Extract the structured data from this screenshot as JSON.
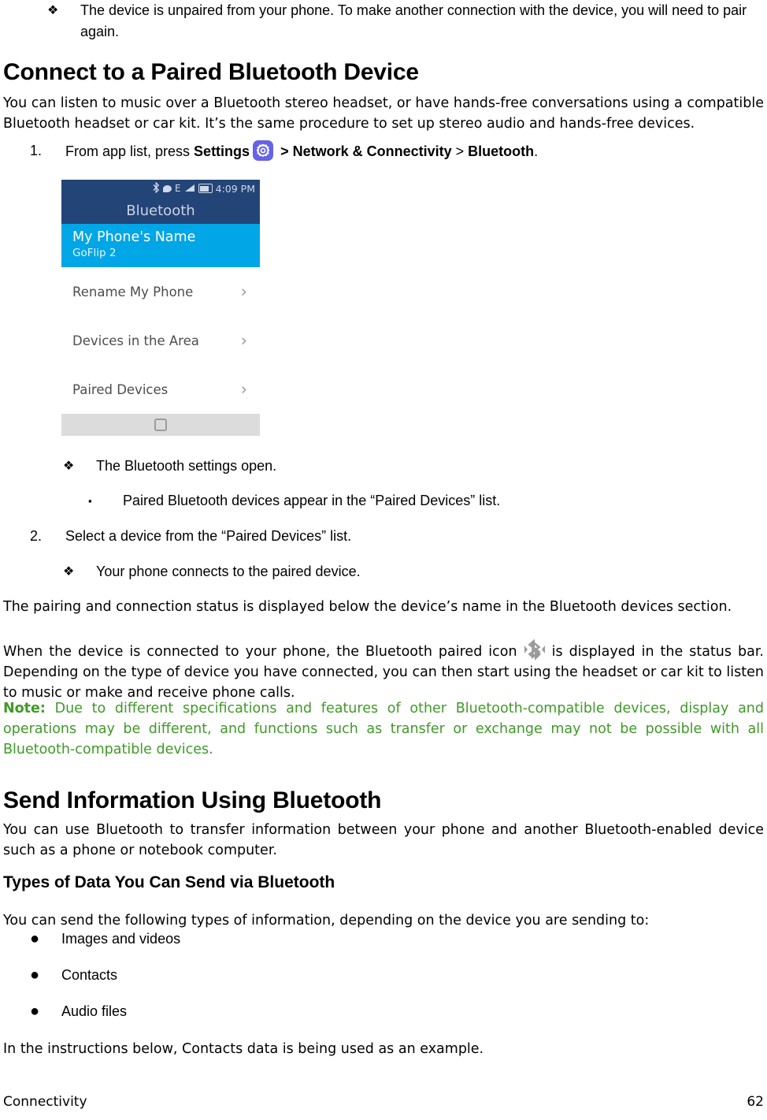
{
  "document": {
    "footer_section": "Connectivity",
    "footer_page": "62"
  },
  "intro": {
    "bullet_marker": "❖",
    "text": "The device is unpaired from your phone. To make another connection with the device, you will need to pair again."
  },
  "connect_section": {
    "heading": "Connect to a Paired Bluetooth Device",
    "intro_paragraph": "You can listen to music over a Bluetooth stereo headset, or have hands-free conversations using a compatible Bluetooth headset or car kit. It’s the same procedure to set up stereo audio and hands-free devices.",
    "step1_number": "1.",
    "step1_prefix": "From app list, press ",
    "step1_settings": "Settings",
    "step1_sep1": " > ",
    "step1_network": "Network & Connectivity",
    "step1_sep2": " > ",
    "step1_bluetooth": "Bluetooth",
    "step1_period": ".",
    "settings_icon_name": "settings-gear-icon",
    "bullet_settings_open_marker": "❖",
    "bullet_settings_open": "The Bluetooth settings open.",
    "bullet_paired_appear_marker": "▪",
    "bullet_paired_appear": "Paired Bluetooth devices appear in the “Paired Devices” list.",
    "step2_number": "2.",
    "step2_text": "Select a device from the “Paired Devices” list.",
    "bullet_connects_marker": "❖",
    "bullet_connects": "Your phone connects to the paired device.",
    "pairing_paragraph": "The pairing and connection status is displayed below the device’s name in the Bluetooth devices section.",
    "when_connected_part1": "When the device is connected to your phone, the Bluetooth paired icon",
    "when_connected_part2": "is displayed in the status bar. Depending on the type of device you have connected, you can then start using the headset or car kit to listen to music or make and receive phone calls.",
    "bluetooth_paired_icon_name": "bluetooth-paired-icon",
    "note_label": "Note:",
    "note_text": " Due to different specifications and features of other Bluetooth-compatible devices, display and operations may be different, and functions such as transfer or exchange may not be possible with all Bluetooth-compatible devices.",
    "note_color": "#3f9a27"
  },
  "phone_screenshot": {
    "status_bar": {
      "bluetooth_glyph": "ᛗ",
      "message_icon_name": "message-bubble-icon",
      "network_type": "E",
      "signal_icon_name": "signal-bars-icon",
      "battery_icon_name": "battery-icon",
      "time": "4:09 PM"
    },
    "title": "Bluetooth",
    "selected_row": {
      "title": "My Phone's Name",
      "subtitle": "GoFlip 2"
    },
    "rows": [
      {
        "label": "Rename My Phone",
        "chevron": "›"
      },
      {
        "label": "Devices in the Area",
        "chevron": "›"
      },
      {
        "label": "Paired Devices",
        "chevron": "›"
      }
    ],
    "nav_bar": {
      "home_icon_name": "home-button-icon"
    },
    "colors": {
      "header": "#234477",
      "selected": "#00a6e6",
      "navbar": "#dcdcdc"
    }
  },
  "send_section": {
    "heading": "Send Information Using Bluetooth",
    "intro_paragraph": "You can use Bluetooth to transfer information between your phone and another Bluetooth-enabled device such as a phone or notebook computer.",
    "subheading": "Types of Data You Can Send via Bluetooth",
    "types_intro": "You can send the following types of information, depending on the device you are sending to:",
    "types": [
      {
        "marker": "●",
        "label": "Images and videos"
      },
      {
        "marker": "●",
        "label": "Contacts"
      },
      {
        "marker": "●",
        "label": "Audio files"
      }
    ],
    "closing_paragraph": "In the instructions below, Contacts data is being used as an example."
  }
}
